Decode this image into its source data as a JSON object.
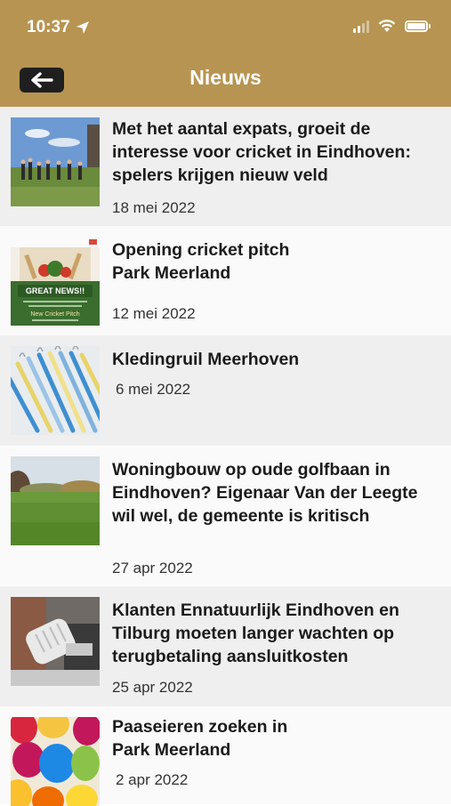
{
  "status": {
    "time": "10:37"
  },
  "header": {
    "title": "Nieuws"
  },
  "news": [
    {
      "title": "Met het aantal expats, groeit de interesse voor cricket in Eindhoven: spelers krijgen nieuw veld",
      "date": "18 mei 2022",
      "image": "cricket-field-photo"
    },
    {
      "title": "Opening cricket pitch\nPark Meerland",
      "date": "12 mei 2022",
      "image": "great-news-cricket-poster",
      "image_text": "GREAT NEWS!!",
      "image_subtext": "New Cricket Pitch"
    },
    {
      "title": "Kledingruil Meerhoven",
      "date": "6 mei 2022",
      "image": "clothes-hangers-photo"
    },
    {
      "title": "Woningbouw op oude golfbaan in Eindhoven? Eigenaar Van der Leegte wil wel, de gemeente is kritisch",
      "date": "27 apr 2022",
      "image": "golf-course-photo"
    },
    {
      "title": "Klanten Ennatuurlijk Eindhoven en Tilburg moeten langer wachten op terugbetaling aansluitkosten",
      "date": "25 apr 2022",
      "image": "thermostat-valve-photo"
    },
    {
      "title": "Paaseieren zoeken in\nPark Meerland",
      "date": "2 apr 2022",
      "image": "easter-eggs-photo"
    }
  ]
}
